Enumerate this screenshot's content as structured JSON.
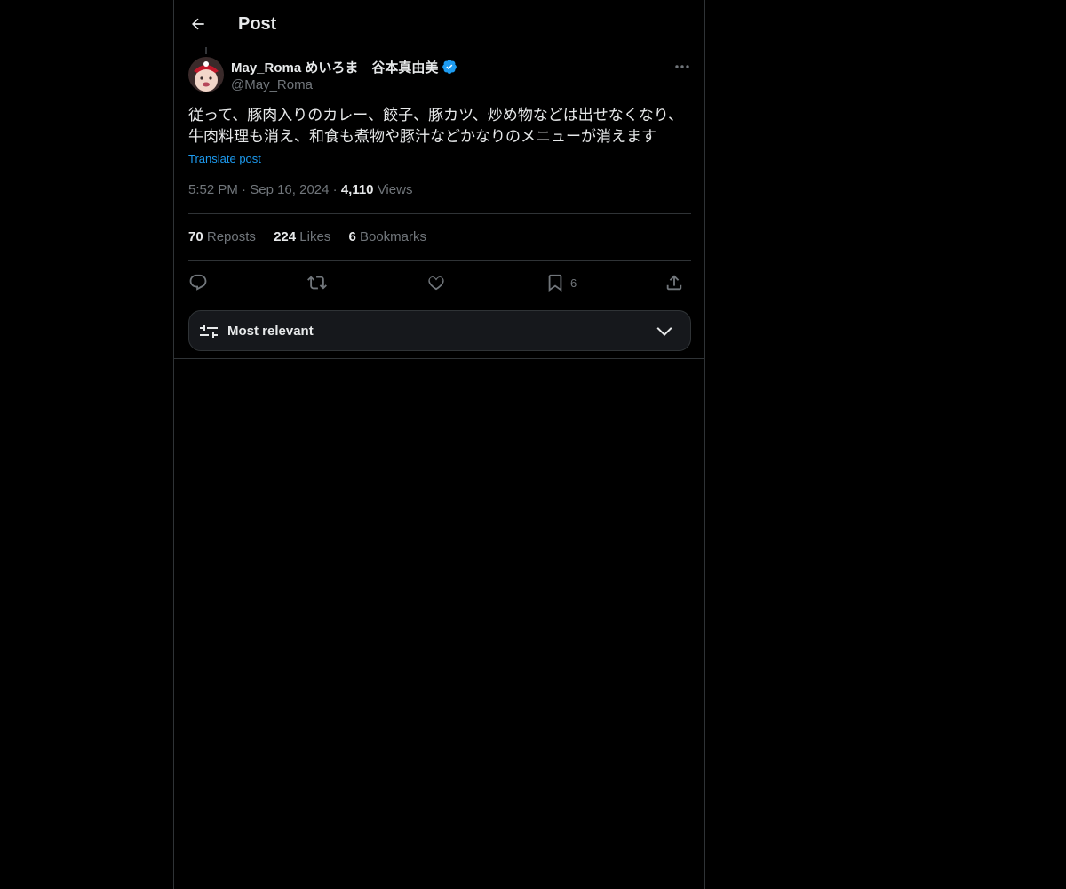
{
  "header": {
    "title": "Post",
    "back_icon": "arrow-left-icon"
  },
  "author": {
    "display_name": "May_Roma めいろま　谷本真由美",
    "handle": "@May_Roma",
    "verified": true,
    "verified_color": "#1d9bf0"
  },
  "post": {
    "text": "従って、豚肉入りのカレー、餃子、豚カツ、炒め物などは出せなくなり、牛肉料理も消え、和食も煮物や豚汁などかなりのメニューが消えます",
    "translate_label": "Translate post",
    "time": "5:52 PM",
    "date": "Sep 16, 2024",
    "views_count": "4,110",
    "views_label": "Views"
  },
  "stats": {
    "reposts_count": "70",
    "reposts_label": "Reposts",
    "likes_count": "224",
    "likes_label": "Likes",
    "bookmarks_count": "6",
    "bookmarks_label": "Bookmarks"
  },
  "actions": {
    "reply_icon": "reply-icon",
    "repost_icon": "repost-icon",
    "like_icon": "heart-icon",
    "bookmark_icon": "bookmark-icon",
    "bookmark_count": "6",
    "share_icon": "share-icon"
  },
  "sort": {
    "label": "Most relevant",
    "icon": "sliders-icon"
  },
  "colors": {
    "background": "#000000",
    "text": "#e7e9ea",
    "muted": "#71767b",
    "accent": "#1d9bf0",
    "border": "#2f3336"
  }
}
